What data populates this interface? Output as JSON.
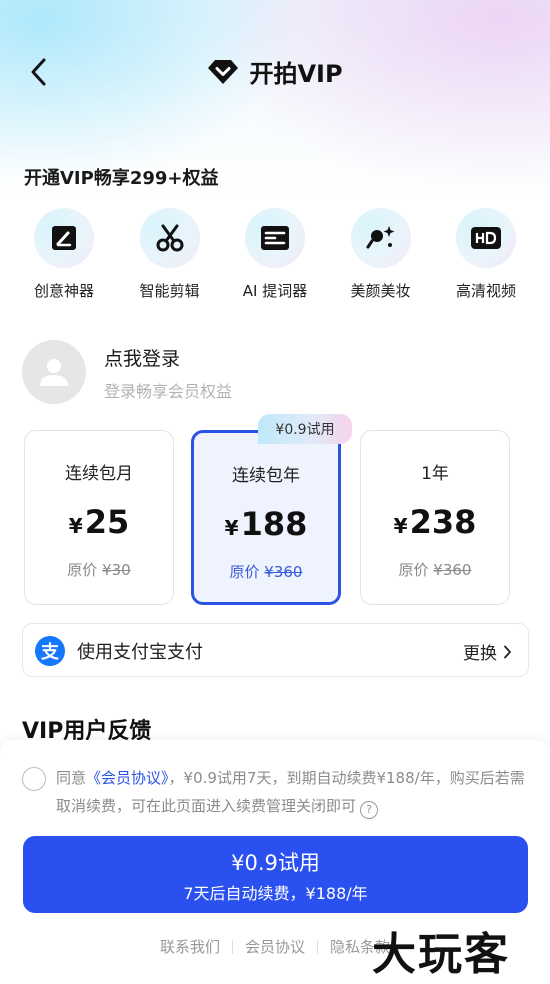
{
  "header": {
    "title": "开拍VIP",
    "back_icon": "chevron-left-icon",
    "logo_icon": "diamond-heart-icon"
  },
  "benefits": {
    "title": "开通VIP畅享299+权益",
    "items": [
      {
        "label": "创意神器",
        "icon": "pen-square-icon"
      },
      {
        "label": "智能剪辑",
        "icon": "scissors-icon"
      },
      {
        "label": "AI 提词器",
        "icon": "teleprompter-icon"
      },
      {
        "label": "美颜美妆",
        "icon": "magic-wand-icon"
      },
      {
        "label": "高清视频",
        "icon": "hd-icon"
      }
    ]
  },
  "login": {
    "title": "点我登录",
    "subtitle": "登录畅享会员权益"
  },
  "plans": [
    {
      "name": "连续包月",
      "currency": "¥",
      "price": "25",
      "orig_label": "原价",
      "orig_price": "¥30",
      "selected": false
    },
    {
      "name": "连续包年",
      "currency": "¥",
      "price": "188",
      "orig_label": "原价",
      "orig_price": "¥360",
      "selected": true
    },
    {
      "name": "1年",
      "currency": "¥",
      "price": "238",
      "orig_label": "原价",
      "orig_price": "¥360",
      "selected": false
    }
  ],
  "trial_badge": "¥0.9试用",
  "payment": {
    "label": "使用支付宝支付",
    "change": "更换",
    "icon_glyph": "支"
  },
  "feedback_title": "VIP用户反馈",
  "agreement": {
    "prefix": "同意",
    "link": "《会员协议》",
    "text": "，¥0.9试用7天，到期自动续费¥188/年，购买后若需取消续费，可在此页面进入续费管理关闭即可",
    "help_glyph": "?"
  },
  "cta": {
    "line1": "¥0.9试用",
    "line2": "7天后自动续费，¥188/年"
  },
  "footer": {
    "contact": "联系我们",
    "agreement": "会员协议",
    "privacy": "隐私条款"
  },
  "watermark": "大玩客",
  "colors": {
    "accent": "#2a50f0",
    "selected_bg": "#eef3fd",
    "alipay": "#1677ff",
    "muted": "#8c8c8c"
  }
}
